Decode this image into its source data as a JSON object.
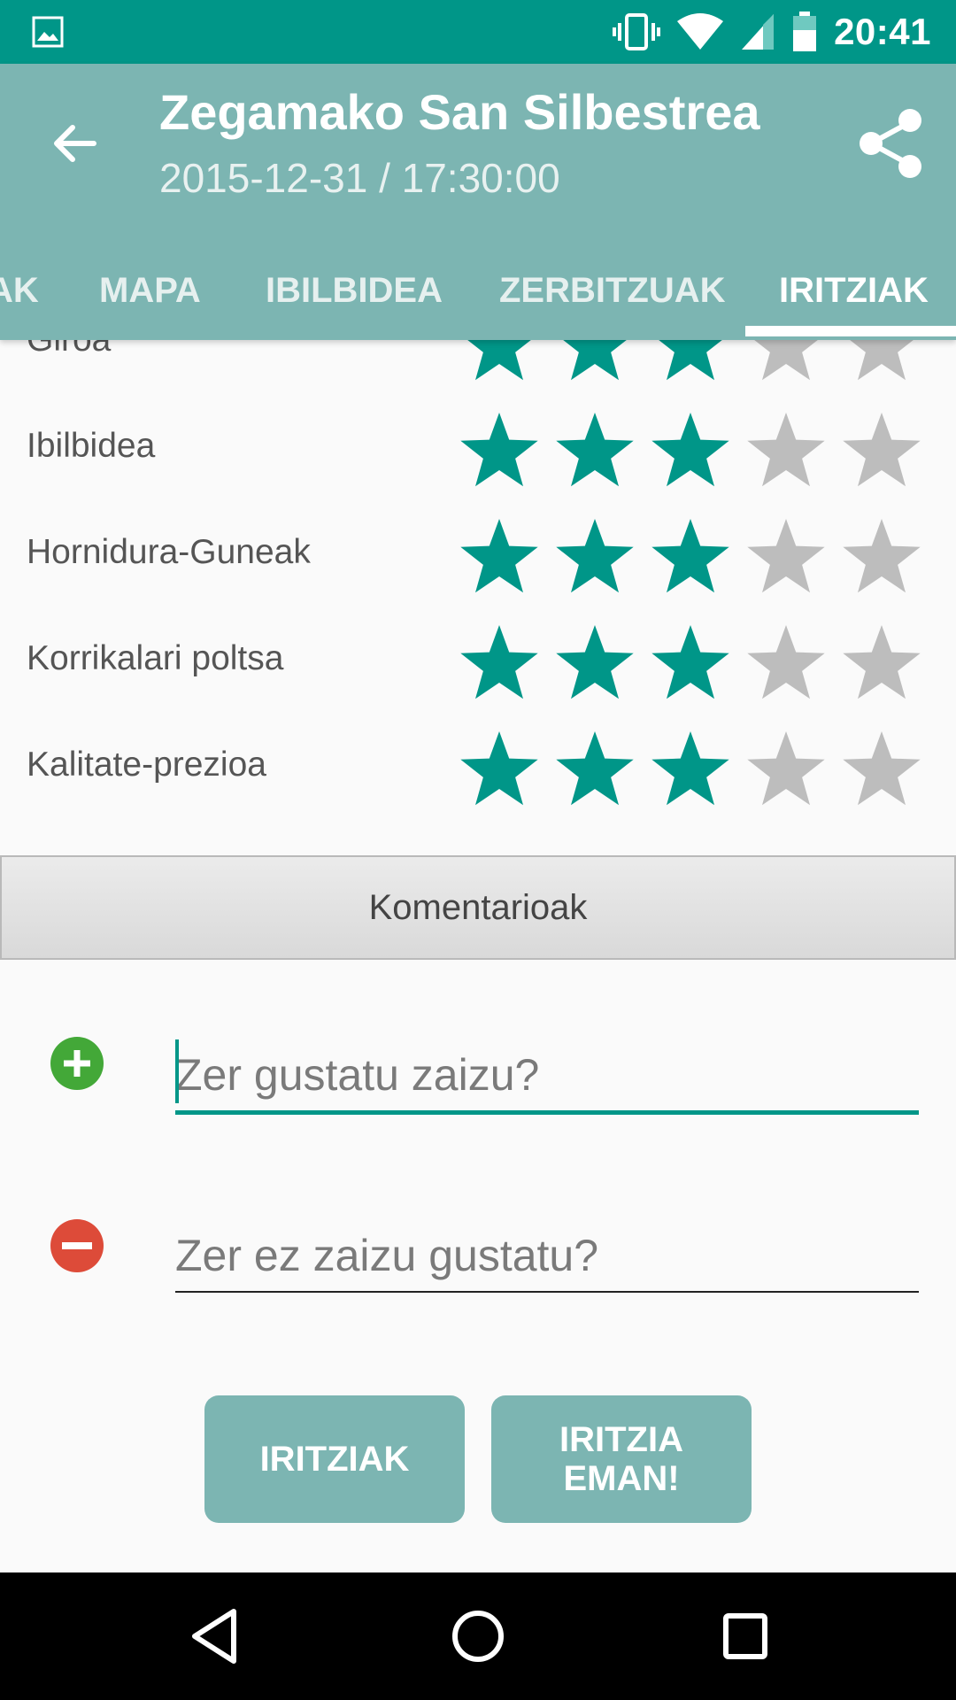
{
  "status_bar": {
    "time": "20:41"
  },
  "app_bar": {
    "title": "Zegamako San Silbestrea",
    "subtitle": "2015-12-31 / 17:30:00"
  },
  "tabs": [
    {
      "label": "AK"
    },
    {
      "label": "MAPA"
    },
    {
      "label": "IBILBIDEA"
    },
    {
      "label": "ZERBITZUAK"
    },
    {
      "label": "IRITZIAK",
      "active": true
    }
  ],
  "ratings": [
    {
      "label": "Giroa",
      "stars": 3,
      "max": 5
    },
    {
      "label": "Ibilbidea",
      "stars": 3,
      "max": 5
    },
    {
      "label": "Hornidura-Guneak",
      "stars": 3,
      "max": 5
    },
    {
      "label": "Korrikalari poltsa",
      "stars": 3,
      "max": 5
    },
    {
      "label": "Kalitate-prezioa",
      "stars": 3,
      "max": 5
    }
  ],
  "comments": {
    "header": "Komentarioak",
    "liked_placeholder": "Zer gustatu zaizu?",
    "disliked_placeholder": "Zer ez zaizu gustatu?"
  },
  "buttons": {
    "reviews": "IRITZIAK",
    "give_review_line1": "IRITZIA",
    "give_review_line2": "EMAN!"
  },
  "colors": {
    "status_bar": "#009688",
    "app_bar": "#7cb5b2",
    "star_filled": "#009688",
    "star_empty": "#bdbdbd",
    "plus_icon": "#43a838",
    "minus_icon": "#dd4b39"
  },
  "icons": [
    "image-icon",
    "vibrate-icon",
    "wifi-icon",
    "signal-icon",
    "battery-icon",
    "back-arrow-icon",
    "share-icon",
    "plus-circle-icon",
    "minus-circle-icon",
    "nav-back-icon",
    "nav-home-icon",
    "nav-recents-icon"
  ]
}
